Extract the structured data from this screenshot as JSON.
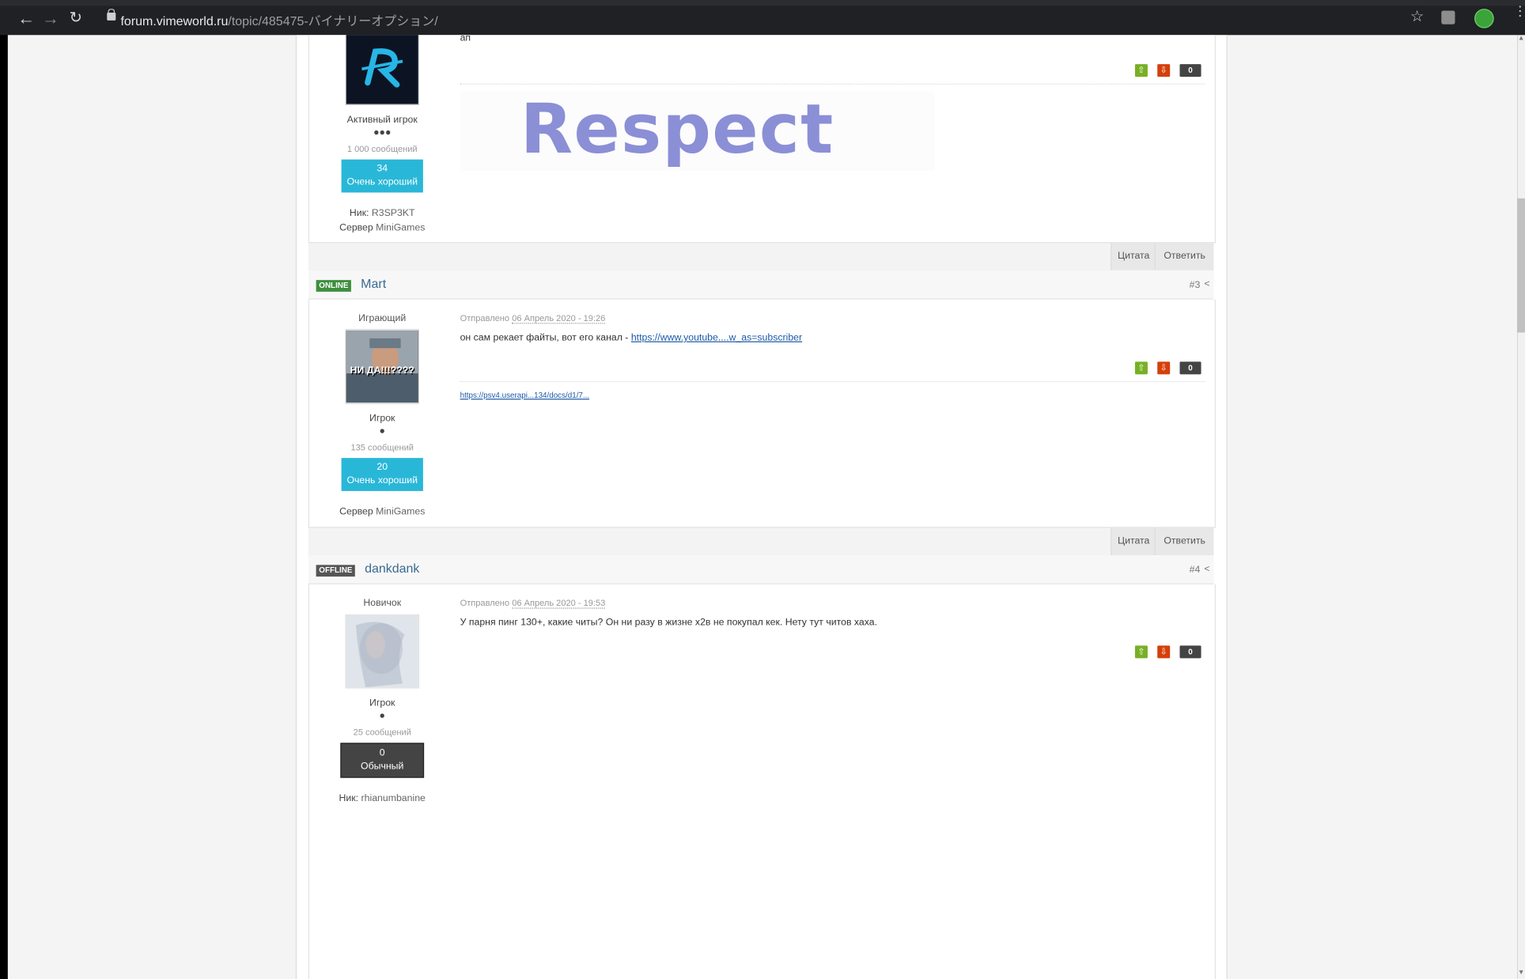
{
  "browser": {
    "url_domain": "forum.vimeworld.ru",
    "url_path": "/topic/485475-バイナリーオプション/",
    "back_icon": "arrow-left-icon",
    "forward_icon": "arrow-right-icon",
    "reload_icon": "reload-icon"
  },
  "post1_partial": {
    "text": "ап",
    "rank": "Активный игрок",
    "pips": "●●●",
    "message_count": "1 000 сообщений",
    "rep_value": "34",
    "rep_label": "Очень хороший",
    "nick_label": "Ник:",
    "nick_value": "R3SP3KT",
    "server_label": "Сервер",
    "server_value": "MiniGames",
    "vote_count": "0",
    "signature_image_text": "Respect"
  },
  "actions": {
    "quote": "Цитата",
    "reply": "Ответить"
  },
  "post2": {
    "status": "ONLINE",
    "username": "Mart",
    "number": "#3",
    "rank_top": "Играющий",
    "avatar_caption": "НИ ДА!!!????",
    "rank": "Игрок",
    "pips": "●",
    "message_count": "135 сообщений",
    "rep_value": "20",
    "rep_label": "Очень хороший",
    "server_label": "Сервер",
    "server_value": "MiniGames",
    "posted_label": "Отправлено",
    "posted_date": "06 Апрель 2020 - 19:26",
    "text": "он сам рекает файты, вот его канал - ",
    "link": "https://www.youtube....w_as=subscriber",
    "vote_count": "0",
    "signature_link": "https://psv4.userapi...134/docs/d1/7..."
  },
  "post3": {
    "status": "OFFLINE",
    "username": "dankdank",
    "number": "#4",
    "rank_top": "Новичок",
    "rank": "Игрок",
    "pips": "●",
    "message_count": "25 сообщений",
    "rep_value": "0",
    "rep_label": "Обычный",
    "nick_label": "Ник:",
    "nick_value": "rhianumbanine",
    "posted_label": "Отправлено",
    "posted_date": "06 Апрель 2020 - 19:53",
    "text": "У парня пинг 130+, какие читы? Он ни разу в жизне х2в не покупал кек. Нету тут читов хаха.",
    "vote_count": "0"
  }
}
